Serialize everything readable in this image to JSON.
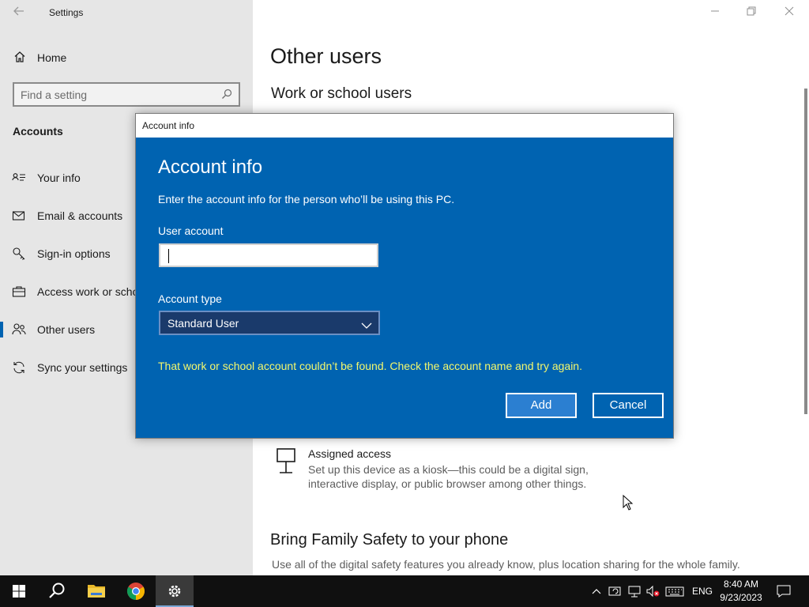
{
  "window": {
    "title": "Settings",
    "back_icon": "back-arrow-icon",
    "controls": [
      "minimize-icon",
      "restore-icon",
      "close-icon"
    ]
  },
  "sidebar": {
    "home_label": "Home",
    "search_placeholder": "Find a setting",
    "section_title": "Accounts",
    "items": [
      {
        "label": "Your info",
        "icon": "person-card-icon"
      },
      {
        "label": "Email & accounts",
        "icon": "mail-icon"
      },
      {
        "label": "Sign-in options",
        "icon": "key-icon"
      },
      {
        "label": "Access work or school",
        "icon": "briefcase-icon"
      },
      {
        "label": "Other users",
        "icon": "people-icon",
        "selected": true
      },
      {
        "label": "Sync your settings",
        "icon": "sync-icon"
      }
    ]
  },
  "main": {
    "title": "Other users",
    "subtitle": "Work or school users",
    "assigned_access": {
      "title": "Assigned access",
      "description": "Set up this device as a kiosk—this could be a digital sign, interactive display, or public browser among other things."
    },
    "family": {
      "title": "Bring Family Safety to your phone",
      "description": "Use all of the digital safety features you already know, plus location sharing for the whole family."
    }
  },
  "dialog": {
    "titlebar": "Account info",
    "heading": "Account info",
    "intro": "Enter the account info for the person who’ll be using this PC.",
    "user_account_label": "User account",
    "user_account_value": "",
    "account_type_label": "Account type",
    "account_type_value": "Standard User",
    "error": "That work or school account couldn’t be found. Check the account name and try again.",
    "add_label": "Add",
    "cancel_label": "Cancel"
  },
  "taskbar": {
    "apps": [
      "windows-start-icon",
      "search-icon",
      "file-explorer-icon",
      "chrome-icon",
      "settings-gear-icon"
    ],
    "language": "ENG",
    "time": "8:40 AM",
    "date": "9/23/2023"
  },
  "colors": {
    "accent": "#0063b1",
    "error_text": "#f3f76d",
    "sidebar_bg": "#e6e6e6",
    "taskbar_bg": "#101010"
  }
}
